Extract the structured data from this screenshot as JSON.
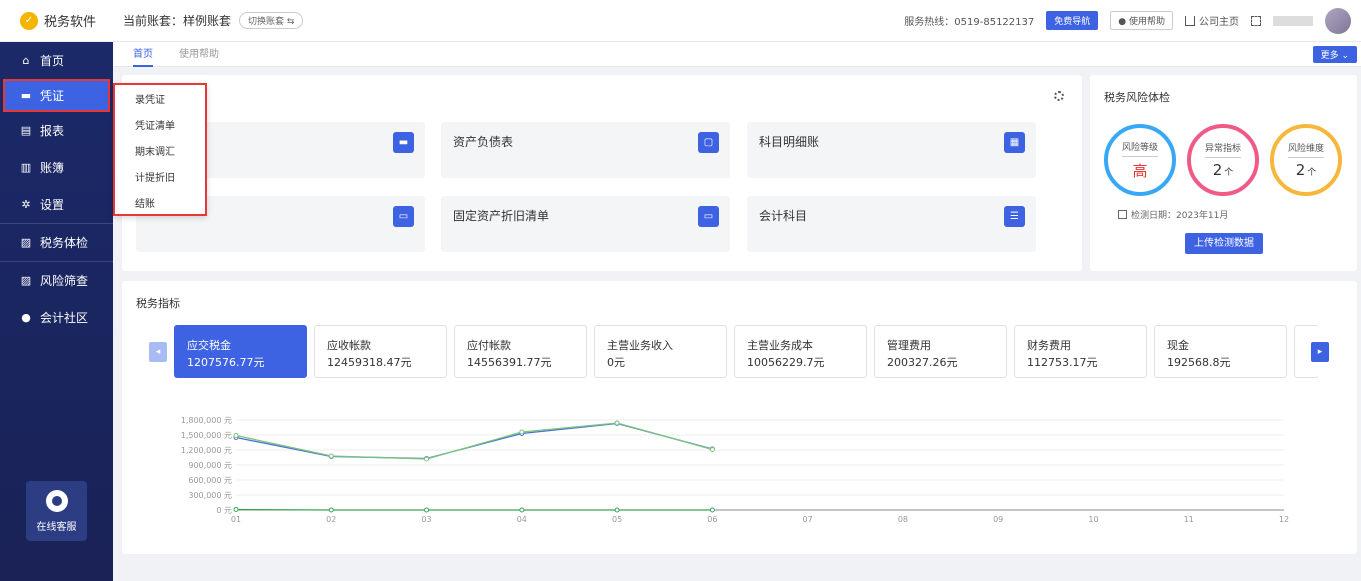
{
  "app": {
    "name": "税务软件"
  },
  "sidebar": {
    "items": [
      {
        "label": "首页",
        "icon": "home-icon"
      },
      {
        "label": "凭证",
        "icon": "voucher-icon"
      },
      {
        "label": "报表",
        "icon": "report-icon"
      },
      {
        "label": "账簿",
        "icon": "ledger-icon"
      },
      {
        "label": "设置",
        "icon": "gear-icon"
      },
      {
        "label": "税务体检",
        "icon": "checkup-icon"
      },
      {
        "label": "风险筛查",
        "icon": "risk-icon"
      },
      {
        "label": "会计社区",
        "icon": "location-icon"
      }
    ],
    "support_label": "在线客服"
  },
  "header": {
    "account_prefix": "当前账套：",
    "account_name": "样例账套",
    "switch_label": "切换账套",
    "hotline_label": "服务热线：",
    "hotline": "0519-85122137",
    "nav_button": "免费导航",
    "help_button": "使用帮助",
    "home_link": "公司主页"
  },
  "tabs": {
    "items": [
      "首页",
      "使用帮助"
    ],
    "more": "更多"
  },
  "dropdown": {
    "items": [
      "录凭证",
      "凭证清单",
      "期末调汇",
      "计提折旧",
      "结账"
    ]
  },
  "quick_cards": [
    {
      "label": "",
      "icon": "voucher-icon"
    },
    {
      "label": "资产负债表",
      "icon": "sheet-icon"
    },
    {
      "label": "科目明细账",
      "icon": "calendar-icon"
    },
    {
      "label": "",
      "icon": "folder-icon"
    },
    {
      "label": "固定资产折旧清单",
      "icon": "screen-icon"
    },
    {
      "label": "会计科目",
      "icon": "list-icon"
    }
  ],
  "risk": {
    "title": "税务风险体检",
    "rings": [
      {
        "label": "风险等级",
        "value": "高",
        "unit": ""
      },
      {
        "label": "异常指标",
        "value": "2",
        "unit": "个"
      },
      {
        "label": "风险维度",
        "value": "2",
        "unit": "个"
      }
    ],
    "check_date": "检测日期：2023年11月",
    "upload_button": "上传检测数据",
    "colors": {
      "ring1": "#38a7f6",
      "ring2": "#ef5b86",
      "ring3": "#f6b73c"
    }
  },
  "tax": {
    "title": "税务指标",
    "metrics": [
      {
        "label": "应交税金",
        "value": "1207576.77元",
        "active": true
      },
      {
        "label": "应收帐款",
        "value": "12459318.47元"
      },
      {
        "label": "应付帐款",
        "value": "14556391.77元"
      },
      {
        "label": "主营业务收入",
        "value": "0元"
      },
      {
        "label": "主营业务成本",
        "value": "10056229.7元"
      },
      {
        "label": "管理费用",
        "value": "200327.26元"
      },
      {
        "label": "财务费用",
        "value": "112753.17元"
      },
      {
        "label": "现金",
        "value": "192568.8元"
      }
    ]
  },
  "chart_data": {
    "type": "line",
    "x": [
      "01",
      "02",
      "03",
      "04",
      "05",
      "06",
      "07",
      "08",
      "09",
      "10",
      "11",
      "12"
    ],
    "yticks": [
      "0 元",
      "300,000 元",
      "600,000 元",
      "900,000 元",
      "1,200,000 元",
      "1,500,000 元",
      "1,800,000 元"
    ],
    "ylim": [
      0,
      1800000
    ],
    "series": [
      {
        "color": "#4a72d8",
        "values": [
          1450000,
          1070000,
          1030000,
          1530000,
          1730000,
          1220000
        ]
      },
      {
        "color": "#7cc47a",
        "values": [
          1490000,
          1080000,
          1020000,
          1560000,
          1740000,
          1210000
        ]
      },
      {
        "color": "#3aa35a",
        "values": [
          10000,
          0,
          0,
          0,
          0,
          0
        ]
      }
    ],
    "grid": true,
    "accent": "#3d63e3"
  }
}
